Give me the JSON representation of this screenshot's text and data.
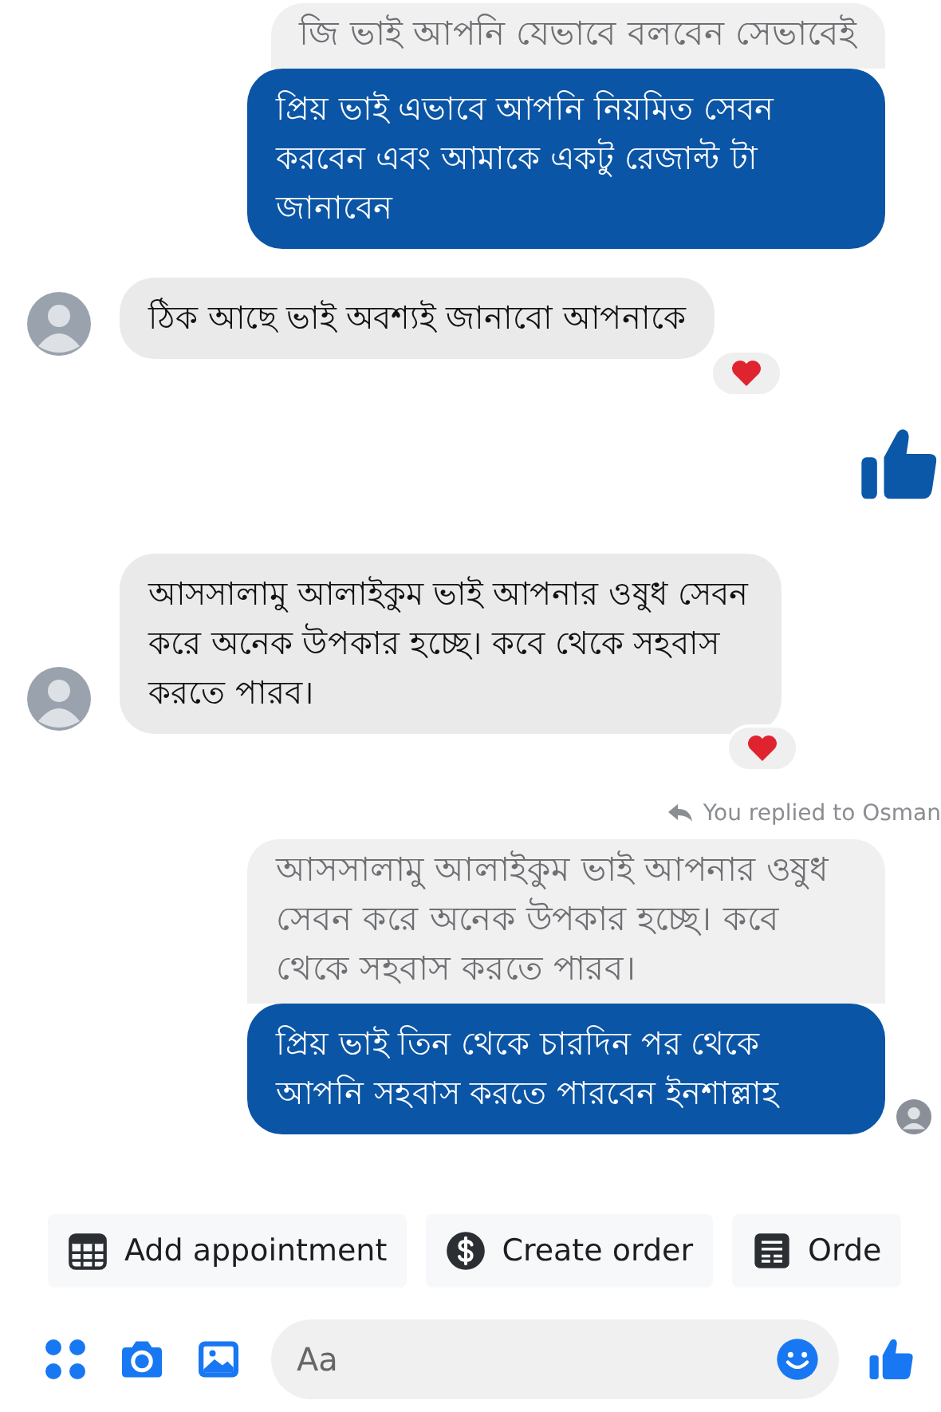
{
  "messages": [
    {
      "kind": "quote",
      "text": "জি ভাই আপনি যেভাবে বলবেন সেভাবেই"
    },
    {
      "kind": "outgoing",
      "text": "প্রিয় ভাই এভাবে আপনি নিয়মিত সেবন করবেন এবং আমাকে একটু রেজাল্ট টা জানাবেন"
    },
    {
      "kind": "incoming",
      "text": "ঠিক আছে ভাই অবশ্যই জানাবো আপনাকে",
      "reacted": true
    },
    {
      "kind": "like"
    },
    {
      "kind": "incoming",
      "text": "আসসালামু আলাইকুম ভাই আপনার ওষুধ সেবন করে অনেক উপকার হচ্ছে। কবে থেকে সহবাস করতে পারব।",
      "reacted": true
    },
    {
      "kind": "reply_note",
      "text": "You replied to Osman"
    },
    {
      "kind": "quote",
      "text": "আসসালামু আলাইকুম ভাই আপনার ওষুধ সেবন করে অনেক উপকার হচ্ছে। কবে থেকে সহবাস করতে পারব।"
    },
    {
      "kind": "outgoing",
      "text": "প্রিয় ভাই তিন থেকে চারদিন পর থেকে আপনি সহবাস করতে পারবেন ইনশাল্লাহ",
      "seen": true
    }
  ],
  "quick_replies": [
    {
      "kind": "calendar",
      "label": "Add appointment"
    },
    {
      "kind": "dollar",
      "label": "Create order"
    },
    {
      "kind": "list",
      "label": "Orde"
    }
  ],
  "composer": {
    "placeholder": "Aa"
  }
}
